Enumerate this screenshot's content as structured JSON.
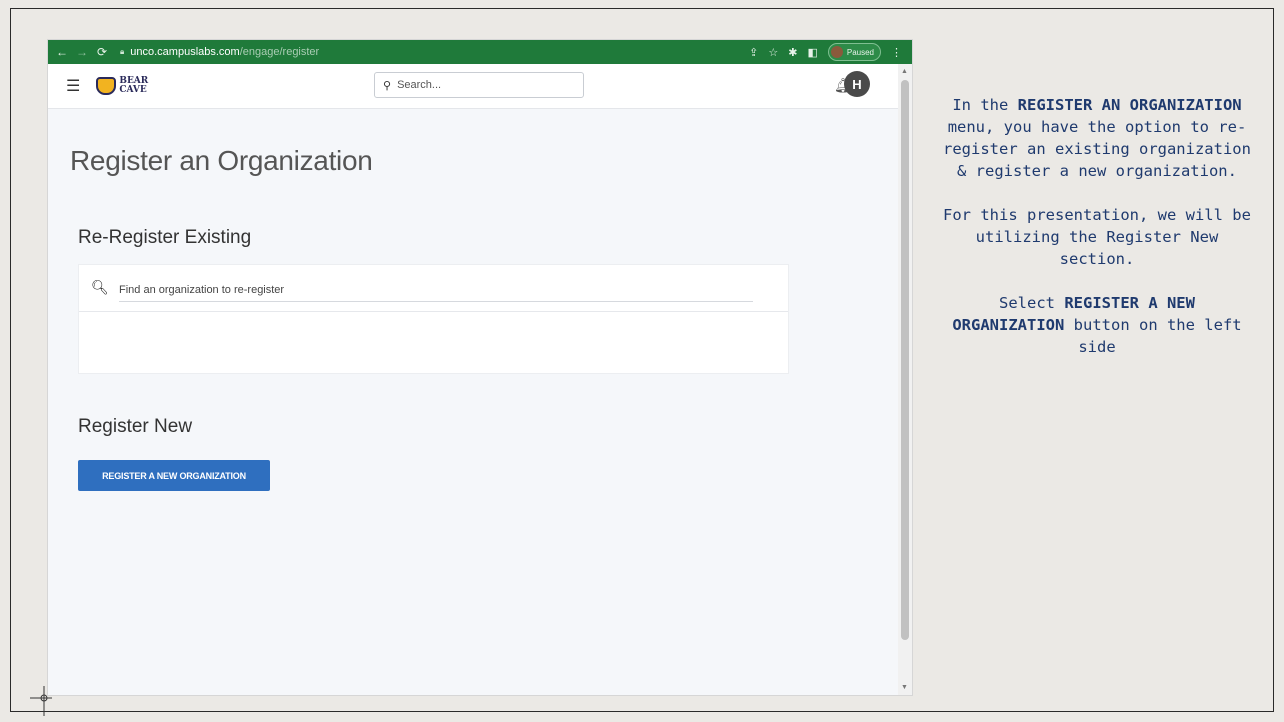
{
  "browser": {
    "url_host": "unco.campuslabs.com",
    "url_path": "/engage/register",
    "profile_status": "Paused"
  },
  "app": {
    "logo_line1": "BEAR",
    "logo_line2": "CAVE",
    "search_placeholder": "Search...",
    "avatar_initial": "H"
  },
  "page": {
    "title": "Register an Organization",
    "re_register": {
      "heading": "Re-Register Existing",
      "search_placeholder": "Find an organization to re-register"
    },
    "register_new": {
      "heading": "Register New",
      "button_label": "REGISTER A NEW ORGANIZATION"
    }
  },
  "instructions": {
    "p1_a": "In the ",
    "p1_bold": "REGISTER AN ORGANIZATION",
    "p1_b": " menu, you have the option to re-register an existing organization & register a new organization.",
    "p2": "For this presentation, we will be utilizing the Register New section.",
    "p3_a": "Select ",
    "p3_bold": "REGISTER A NEW ORGANIZATION",
    "p3_b": " button on the left side"
  },
  "colors": {
    "chrome_green": "#1f7a3a",
    "button_blue": "#2f6fbf",
    "instruction_text": "#1f3a6e"
  }
}
